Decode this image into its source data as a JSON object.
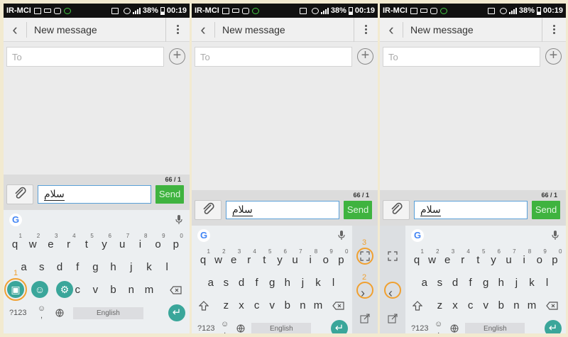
{
  "status": {
    "carrier": "IR-MCI",
    "battery": "38%",
    "time": "00:19"
  },
  "appbar": {
    "title": "New message"
  },
  "to_placeholder": "To",
  "counter": "66 / 1",
  "message": "سلام",
  "send_label": "Send",
  "google_label": "G",
  "keyboard": {
    "row1": [
      "q",
      "w",
      "e",
      "r",
      "t",
      "y",
      "u",
      "i",
      "o",
      "p"
    ],
    "row1_hints": [
      "1",
      "2",
      "3",
      "4",
      "5",
      "6",
      "7",
      "8",
      "9",
      "0"
    ],
    "row2": [
      "a",
      "s",
      "d",
      "f",
      "g",
      "h",
      "j",
      "k",
      "l"
    ],
    "row3": [
      "z",
      "x",
      "c",
      "v",
      "b",
      "n",
      "m"
    ],
    "row3_panel1": [
      "c",
      "v",
      "b",
      "n",
      "m"
    ],
    "symbols": "?123",
    "space_label": "English",
    "emoji_key": "☺",
    "comma": ","
  },
  "annotations": [
    "1",
    "2",
    "3"
  ],
  "colors": {
    "accent": "#3fb33f",
    "keyboard_accent": "#3aa69a",
    "annotation": "#f0a030"
  }
}
